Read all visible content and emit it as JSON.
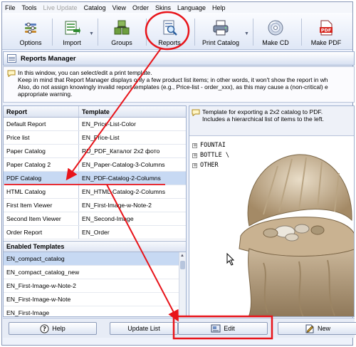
{
  "menu": [
    "File",
    "Tools",
    "Live Update",
    "Catalog",
    "View",
    "Order",
    "Skins",
    "Language",
    "Help"
  ],
  "menu_disabled": [
    "Live Update"
  ],
  "toolbar": {
    "options": "Options",
    "import": "Import",
    "groups": "Groups",
    "reports": "Reports",
    "print_catalog": "Print Catalog",
    "make_cd": "Make CD",
    "make_pdf": "Make PDF",
    "pdf_badge": "PDF"
  },
  "panel": {
    "title": "Reports Manager",
    "info_lines": [
      "In this window, you can select/edit a print template.",
      "Keep in mind that Report Manager displays only a few product list items; in other words, it won't show the report in wh",
      "Also, do not assign knowingly invalid report templates (e.g., Price-list - order_xxx), as this may cause a (non-critical) e",
      "appropriate warning."
    ]
  },
  "reports_table": {
    "headers": [
      "Report",
      "Template"
    ],
    "rows": [
      [
        "Default Report",
        "EN_Price-List-Color"
      ],
      [
        "Price list",
        "EN_Price-List"
      ],
      [
        "Paper Catalog",
        "RU_PDF_Каталог 2x2 фото"
      ],
      [
        "Paper Catalog 2",
        "EN_Paper-Catalog-3-Columns"
      ],
      [
        "PDF Catalog",
        "EN_PDF-Catalog-2-Columns"
      ],
      [
        "HTML Catalog",
        "EN_HTML-Catalog-2-Columns"
      ],
      [
        "First Item Viewer",
        "EN_First-Image-w-Note-2"
      ],
      [
        "Second Item Viewer",
        "EN_Second-Image"
      ],
      [
        "Order Report",
        "EN_Order"
      ]
    ],
    "selected_index": 4
  },
  "enabled_templates": {
    "header": "Enabled Templates",
    "items": [
      "EN_compact_catalog",
      "EN_compact_catalog_new",
      "EN_First-Image-w-Note-2",
      "EN_First-Image-w-Note",
      "EN_First-Image"
    ],
    "selected_index": 0
  },
  "template_description": [
    "Template for exporting a 2x2 catalog to PDF.",
    "Includes a hierarchical list of items to the left."
  ],
  "tree_items": [
    "FOUNTAI",
    "BOTTLE \\",
    "OTHER"
  ],
  "buttons": {
    "help": "Help",
    "update_list": "Update List",
    "edit": "Edit",
    "new": "New"
  },
  "colors": {
    "annotation_red": "#e8141a",
    "selection": "#c7d9f3",
    "window_bg": "#eef2fb"
  },
  "icons": [
    "options-icon",
    "import-icon",
    "groups-icon",
    "reports-icon",
    "print-catalog-icon",
    "make-cd-icon",
    "make-pdf-icon",
    "help-icon",
    "edit-icon",
    "new-icon"
  ]
}
